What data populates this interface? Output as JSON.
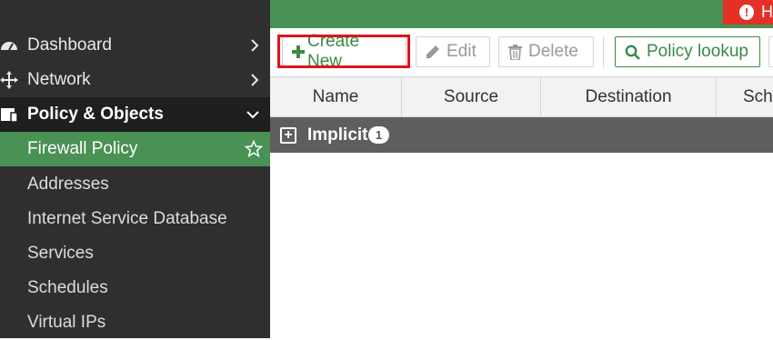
{
  "sidebar": {
    "items": [
      {
        "label": "Dashboard",
        "icon": "dashboard-icon",
        "chevron": "›"
      },
      {
        "label": "Network",
        "icon": "network-icon",
        "chevron": "›"
      },
      {
        "label": "Policy & Objects",
        "icon": "policy-icon",
        "chevron": "⌄"
      },
      {
        "label": "Firewall Policy",
        "icon": "star-icon"
      },
      {
        "label": "Addresses"
      },
      {
        "label": "Internet Service Database"
      },
      {
        "label": "Services"
      },
      {
        "label": "Schedules"
      },
      {
        "label": "Virtual IPs"
      }
    ]
  },
  "topbar": {
    "alert_text": "H"
  },
  "toolbar": {
    "create_label": "Create New",
    "edit_label": "Edit",
    "delete_label": "Delete",
    "lookup_label": "Policy lookup"
  },
  "table": {
    "columns": [
      "Name",
      "Source",
      "Destination",
      "Sch"
    ],
    "group": {
      "label": "Implicit",
      "count": "1"
    }
  },
  "colors": {
    "accent": "#4a9154",
    "alert": "#e33127",
    "highlight": "#e0141e",
    "sidebar": "#2f2f2f"
  }
}
